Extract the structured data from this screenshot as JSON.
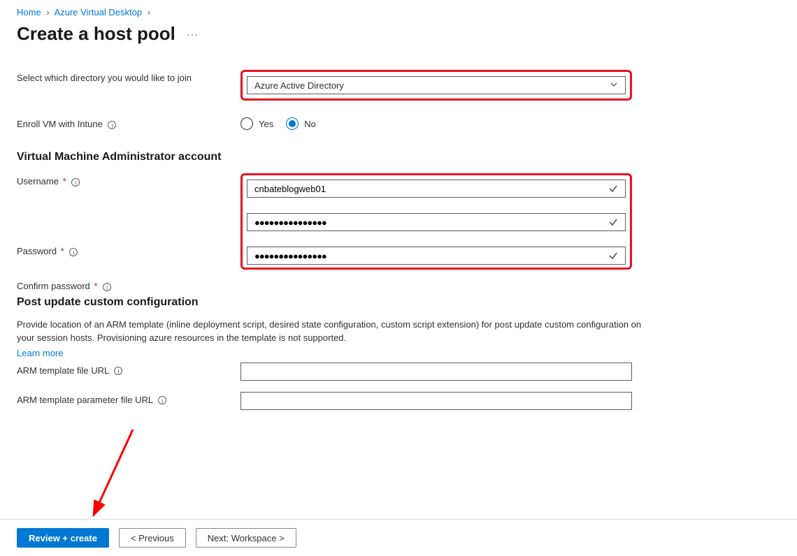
{
  "breadcrumb": {
    "home": "Home",
    "avd": "Azure Virtual Desktop"
  },
  "page": {
    "title": "Create a host pool"
  },
  "directory": {
    "label": "Select which directory you would like to join",
    "value": "Azure Active Directory"
  },
  "intune": {
    "label": "Enroll VM with Intune",
    "yes": "Yes",
    "no": "No",
    "selected": "No"
  },
  "sections": {
    "admin": "Virtual Machine Administrator account",
    "post": "Post update custom configuration"
  },
  "admin": {
    "username_label": "Username",
    "username_value": "cnbateblogweb01",
    "password_label": "Password",
    "password_value": "●●●●●●●●●●●●●●●",
    "confirm_label": "Confirm password",
    "confirm_value": "●●●●●●●●●●●●●●●"
  },
  "post": {
    "desc": "Provide location of an ARM template (inline deployment script, desired state configuration, custom script extension) for post update custom configuration on your session hosts. Provisioning azure resources in the template is not supported.",
    "learn": "Learn more",
    "arm_file_label": "ARM template file URL",
    "arm_param_label": "ARM template parameter file URL"
  },
  "footer": {
    "review": "Review + create",
    "previous": "<  Previous",
    "next": "Next: Workspace  >"
  }
}
